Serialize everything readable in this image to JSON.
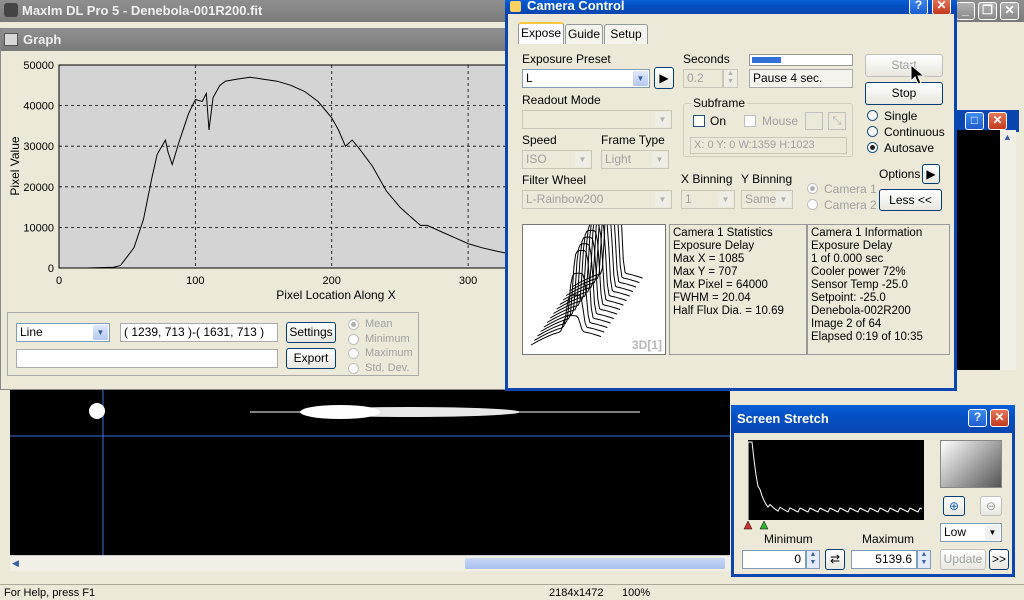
{
  "app": {
    "title": "MaxIm DL Pro 5 - Denebola-001R200.fit",
    "minimize": "_",
    "restore": "❐",
    "close": "✕"
  },
  "graph": {
    "title": "Graph",
    "chart_data": {
      "type": "line",
      "xlabel": "Pixel Location Along X",
      "ylabel": "Pixel Value",
      "xlim": [
        0,
        330
      ],
      "ylim": [
        0,
        50000
      ],
      "xticks": [
        "0",
        "100",
        "200",
        "300"
      ],
      "yticks": [
        "0",
        "10000",
        "20000",
        "30000",
        "40000",
        "50000"
      ],
      "grid": true,
      "x": [
        0,
        20,
        40,
        45,
        55,
        62,
        68,
        72,
        78,
        80,
        83,
        88,
        95,
        100,
        105,
        108,
        110,
        113,
        118,
        122,
        130,
        140,
        150,
        160,
        170,
        180,
        190,
        200,
        205,
        210,
        215,
        220,
        230,
        240,
        250,
        255,
        260,
        265,
        270,
        280,
        290,
        300,
        310,
        320,
        330
      ],
      "y": [
        0,
        0,
        200,
        600,
        5000,
        12000,
        22000,
        28000,
        31500,
        28500,
        25500,
        31000,
        38000,
        41500,
        41000,
        43000,
        34000,
        42000,
        45000,
        46000,
        46500,
        47000,
        46500,
        46000,
        45000,
        43500,
        41000,
        37000,
        34000,
        30000,
        31500,
        29500,
        25000,
        19000,
        15000,
        13500,
        12000,
        10500,
        10500,
        9000,
        7500,
        6000,
        5000,
        4200,
        3500
      ]
    },
    "mode_select": "Line",
    "coords": "( 1239, 713 )-( 1631, 713 )",
    "secondary": "",
    "settings_label": "Settings",
    "export_label": "Export",
    "stats": [
      "Mean",
      "Minimum",
      "Maximum",
      "Std. Dev."
    ]
  },
  "camera": {
    "title": "Camera Control",
    "help": "?",
    "close": "✕",
    "tabs": [
      "Expose",
      "Guide",
      "Setup"
    ],
    "exposure_preset_label": "Exposure Preset",
    "exposure_preset_value": "L",
    "seconds_label": "Seconds",
    "seconds_value": "0.2",
    "progress": 0.3,
    "status": "Pause 4 sec.",
    "start_label": "Start",
    "stop_label": "Stop",
    "readout_label": "Readout Mode",
    "readout_value": "",
    "subframe_label": "Subframe",
    "on_label": "On",
    "mouse_label": "Mouse",
    "subframe_coords": "X:   0 Y:    0 W:1359 H:1023",
    "single_label": "Single",
    "continuous_label": "Continuous",
    "autosave_label": "Autosave",
    "options_label": "Options",
    "speed_label": "Speed",
    "speed_value": "ISO",
    "frametype_label": "Frame Type",
    "frametype_value": "Light",
    "filterwheel_label": "Filter Wheel",
    "filterwheel_value": "L-Rainbow200",
    "xbin_label": "X Binning",
    "xbin_value": "1",
    "ybin_label": "Y Binning",
    "ybin_value": "Same",
    "camera1_label": "Camera 1",
    "camera2_label": "Camera 2",
    "less_label": "Less <<",
    "plot_label": "3D[1]",
    "stats_lines": [
      "Camera 1 Statistics",
      "Exposure Delay",
      "Max X = 1085",
      "Max Y = 707",
      "Max Pixel = 64000",
      "FWHM = 20.04",
      "Half Flux Dia. = 10.69"
    ],
    "info_lines": [
      "Camera 1 Information",
      "Exposure Delay",
      "1 of 0.000 sec",
      "Cooler power 72%",
      "Sensor Temp -25.0",
      "Setpoint: -25.0",
      "Denebola-002R200",
      "Image 2 of 64",
      "Elapsed 0:19 of 10:35"
    ]
  },
  "stretch": {
    "title": "Screen Stretch",
    "help": "?",
    "close": "✕",
    "minimum_label": "Minimum",
    "maximum_label": "Maximum",
    "minimum_value": "0",
    "maximum_value": "5139.6",
    "mode_value": "Low",
    "update_label": "Update",
    "more_label": ">>"
  },
  "status": {
    "help": "For Help, press F1",
    "size": "2184x1472",
    "zoom": "100%"
  }
}
